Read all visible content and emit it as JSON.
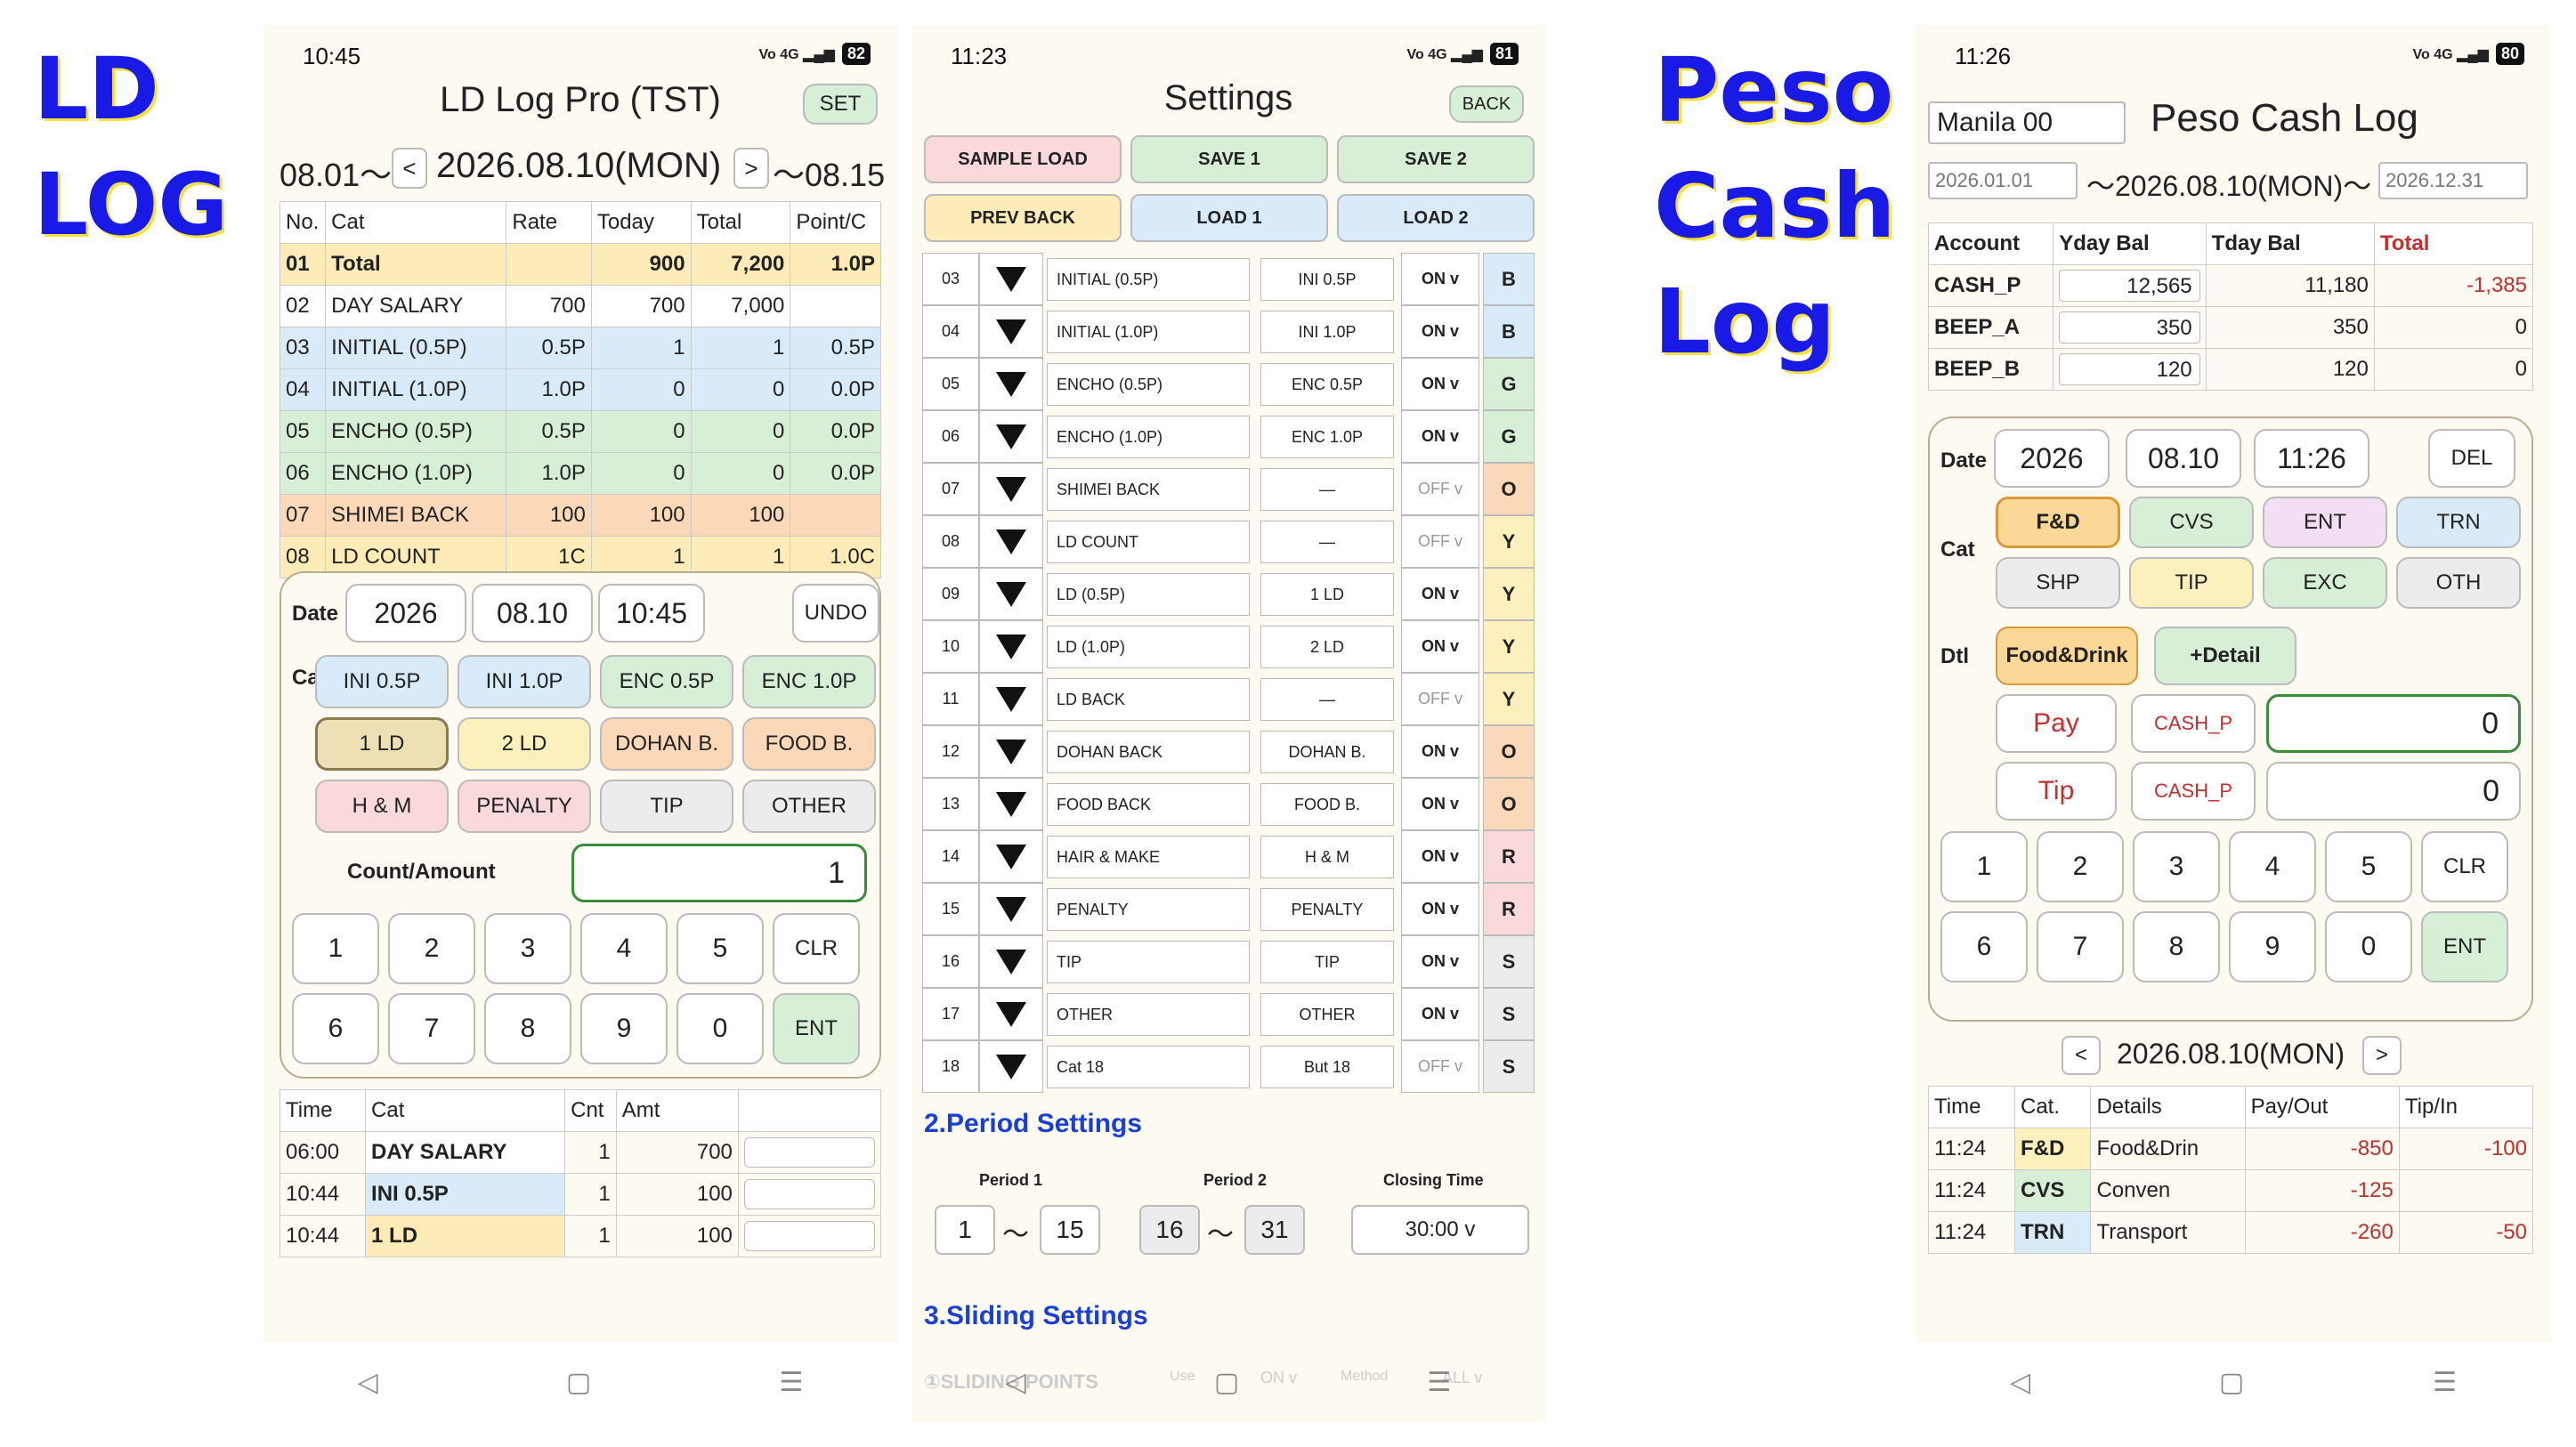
{
  "labels": {
    "ld1": "LD",
    "ld2": "LOG",
    "peso1": "Peso",
    "peso2": "Cash",
    "peso3": "Log"
  },
  "nav": {
    "back": "◁",
    "home": "▢",
    "menu": "☰"
  },
  "p1": {
    "status_time": "10:45",
    "net": "Vo LTE 4G",
    "battery": "82",
    "title": "LD Log Pro (TST)",
    "set": "SET",
    "period_start": "08.01〜",
    "prev": "<",
    "date": "2026.08.10(MON)",
    "next": ">",
    "period_end": "〜08.15",
    "headers": [
      "No.",
      "Cat",
      "Rate",
      "Today",
      "Total",
      "Point/C"
    ],
    "rows": [
      {
        "no": "01",
        "cat": "Total",
        "rate": "",
        "today": "900",
        "total": "7,200",
        "point": "1.0P",
        "color": "#fdebb8"
      },
      {
        "no": "02",
        "cat": "DAY SALARY",
        "rate": "700",
        "today": "700",
        "total": "7,000",
        "point": "",
        "color": "#ffffff"
      },
      {
        "no": "03",
        "cat": "INITIAL (0.5P)",
        "rate": "0.5P",
        "today": "1",
        "total": "1",
        "point": "0.5P",
        "color": "#d9ebf8"
      },
      {
        "no": "04",
        "cat": "INITIAL (1.0P)",
        "rate": "1.0P",
        "today": "0",
        "total": "0",
        "point": "0.0P",
        "color": "#d9ebf8"
      },
      {
        "no": "05",
        "cat": "ENCHO (0.5P)",
        "rate": "0.5P",
        "today": "0",
        "total": "0",
        "point": "0.0P",
        "color": "#d7efd6"
      },
      {
        "no": "06",
        "cat": "ENCHO (1.0P)",
        "rate": "1.0P",
        "today": "0",
        "total": "0",
        "point": "0.0P",
        "color": "#d7efd6"
      },
      {
        "no": "07",
        "cat": "SHIMEI BACK",
        "rate": "100",
        "today": "100",
        "total": "100",
        "point": "",
        "color": "#fbd9b8"
      },
      {
        "no": "08",
        "cat": "LD COUNT",
        "rate": "1C",
        "today": "1",
        "total": "1",
        "point": "1.0C",
        "color": "#fdebb8"
      }
    ],
    "date_label": "Date",
    "year": "2026",
    "md": "08.10",
    "time": "10:45",
    "undo": "UNDO",
    "cat_label": "Cat",
    "cats": [
      {
        "t": "INI 0.5P",
        "c": "#d9ebf8"
      },
      {
        "t": "INI 1.0P",
        "c": "#d9ebf8"
      },
      {
        "t": "ENC 0.5P",
        "c": "#d7efd6"
      },
      {
        "t": "ENC 1.0P",
        "c": "#d7efd6"
      },
      {
        "t": "1 LD",
        "c": "#ece0b4"
      },
      {
        "t": "2 LD",
        "c": "#fcf0bc"
      },
      {
        "t": "DOHAN B.",
        "c": "#fbd9b8"
      },
      {
        "t": "FOOD B.",
        "c": "#fbd9b8"
      },
      {
        "t": "H & M",
        "c": "#f9d9d9"
      },
      {
        "t": "PENALTY",
        "c": "#f9d9d9"
      },
      {
        "t": "TIP",
        "c": "#ececec"
      },
      {
        "t": "OTHER",
        "c": "#ececec"
      }
    ],
    "count_label": "Count/Amount",
    "count_value": "1",
    "keys": [
      "1",
      "2",
      "3",
      "4",
      "5",
      "CLR",
      "6",
      "7",
      "8",
      "9",
      "0",
      "ENT"
    ],
    "log_headers": [
      "Time",
      "Cat",
      "Cnt",
      "Amt",
      ""
    ],
    "logs": [
      {
        "time": "06:00",
        "cat": "DAY SALARY",
        "cnt": "1",
        "amt": "700",
        "color": "#ffffff"
      },
      {
        "time": "10:44",
        "cat": "INI 0.5P",
        "cnt": "1",
        "amt": "100",
        "color": "#d9ebf8"
      },
      {
        "time": "10:44",
        "cat": "1 LD",
        "cnt": "1",
        "amt": "100",
        "color": "#fdebb8"
      }
    ]
  },
  "p2": {
    "status_time": "11:23",
    "battery": "81",
    "title": "Settings",
    "back": "BACK",
    "buttons": [
      {
        "t": "SAMPLE LOAD",
        "c": "#f9d9d9"
      },
      {
        "t": "SAVE 1",
        "c": "#d7efd6"
      },
      {
        "t": "SAVE 2",
        "c": "#d7efd6"
      },
      {
        "t": "PREV BACK",
        "c": "#fdebb8"
      },
      {
        "t": "LOAD 1",
        "c": "#d9ebf8"
      },
      {
        "t": "LOAD 2",
        "c": "#d9ebf8"
      }
    ],
    "rows": [
      {
        "n": "03",
        "name": "INITIAL (0.5P)",
        "btn": "INI 0.5P",
        "on": "ON v",
        "g": "B",
        "c": "#d9ebf8"
      },
      {
        "n": "04",
        "name": "INITIAL (1.0P)",
        "btn": "INI 1.0P",
        "on": "ON v",
        "g": "B",
        "c": "#d9ebf8"
      },
      {
        "n": "05",
        "name": "ENCHO (0.5P)",
        "btn": "ENC 0.5P",
        "on": "ON v",
        "g": "G",
        "c": "#d7efd6"
      },
      {
        "n": "06",
        "name": "ENCHO (1.0P)",
        "btn": "ENC 1.0P",
        "on": "ON v",
        "g": "G",
        "c": "#d7efd6"
      },
      {
        "n": "07",
        "name": "SHIMEI BACK",
        "btn": "—",
        "on": "OFF v",
        "g": "O",
        "c": "#fbd9b8"
      },
      {
        "n": "08",
        "name": "LD COUNT",
        "btn": "—",
        "on": "OFF v",
        "g": "Y",
        "c": "#fcf0bc"
      },
      {
        "n": "09",
        "name": "LD (0.5P)",
        "btn": "1 LD",
        "on": "ON v",
        "g": "Y",
        "c": "#fcf0bc"
      },
      {
        "n": "10",
        "name": "LD (1.0P)",
        "btn": "2 LD",
        "on": "ON v",
        "g": "Y",
        "c": "#fcf0bc"
      },
      {
        "n": "11",
        "name": "LD BACK",
        "btn": "—",
        "on": "OFF v",
        "g": "Y",
        "c": "#fcf0bc"
      },
      {
        "n": "12",
        "name": "DOHAN BACK",
        "btn": "DOHAN B.",
        "on": "ON v",
        "g": "O",
        "c": "#fbd9b8"
      },
      {
        "n": "13",
        "name": "FOOD BACK",
        "btn": "FOOD B.",
        "on": "ON v",
        "g": "O",
        "c": "#fbd9b8"
      },
      {
        "n": "14",
        "name": "HAIR & MAKE",
        "btn": "H & M",
        "on": "ON v",
        "g": "R",
        "c": "#f9d9d9"
      },
      {
        "n": "15",
        "name": "PENALTY",
        "btn": "PENALTY",
        "on": "ON v",
        "g": "R",
        "c": "#f9d9d9"
      },
      {
        "n": "16",
        "name": "TIP",
        "btn": "TIP",
        "on": "ON v",
        "g": "S",
        "c": "#ececec"
      },
      {
        "n": "17",
        "name": "OTHER",
        "btn": "OTHER",
        "on": "ON v",
        "g": "S",
        "c": "#ececec"
      },
      {
        "n": "18",
        "name": "Cat 18",
        "btn": "But 18",
        "on": "OFF v",
        "g": "S",
        "c": "#ececec"
      }
    ],
    "period_head": "2.Period Settings",
    "period1": "Period 1",
    "period2": "Period 2",
    "closing": "Closing Time",
    "p1a": "1",
    "p1b": "15",
    "p2a": "16",
    "p2b": "31",
    "tilde": "〜",
    "close_val": "30:00  v",
    "sliding_head": "3.Sliding Settings",
    "sliding_row": "①SLIDING POINTS",
    "use": "Use",
    "use_val": "ON  v",
    "method": "Method",
    "method_val": "ALL  v"
  },
  "p3": {
    "status_time": "11:26",
    "battery": "80",
    "account_name": "Manila 00",
    "title": "Peso Cash Log",
    "from": "2026.01.01",
    "date": "〜2026.08.10(MON)〜",
    "to": "2026.12.31",
    "acc_headers": [
      "Account",
      "Yday Bal",
      "Tday Bal",
      "Total"
    ],
    "accounts": [
      {
        "name": "CASH_P",
        "yday": "12,565",
        "tday": "11,180",
        "total": "-1,385"
      },
      {
        "name": "BEEP_A",
        "yday": "350",
        "tday": "350",
        "total": "0"
      },
      {
        "name": "BEEP_B",
        "yday": "120",
        "tday": "120",
        "total": "0"
      }
    ],
    "date_label": "Date",
    "year": "2026",
    "md": "08.10",
    "time": "11:26",
    "del": "DEL",
    "cat_label": "Cat",
    "cats": [
      {
        "t": "F&D",
        "c": "#fcd896"
      },
      {
        "t": "CVS",
        "c": "#d7efd6"
      },
      {
        "t": "ENT",
        "c": "#f3dff3"
      },
      {
        "t": "TRN",
        "c": "#d9ebf8"
      },
      {
        "t": "SHP",
        "c": "#ececec"
      },
      {
        "t": "TIP",
        "c": "#fcf0bc"
      },
      {
        "t": "EXC",
        "c": "#d7efd6"
      },
      {
        "t": "OTH",
        "c": "#ececec"
      }
    ],
    "dtl_label": "Dtl",
    "dtl1": "Food&Drink",
    "dtl2": "+Detail",
    "pay": "Pay",
    "pay_acc": "CASH_P",
    "pay_val": "0",
    "tip": "Tip",
    "tip_acc": "CASH_P",
    "tip_val": "0",
    "keys": [
      "1",
      "2",
      "3",
      "4",
      "5",
      "CLR",
      "6",
      "7",
      "8",
      "9",
      "0",
      "ENT"
    ],
    "prev": "<",
    "nav_date": "2026.08.10(MON)",
    "next": ">",
    "log_headers": [
      "Time",
      "Cat.",
      "Details",
      "Pay/Out",
      "Tip/In"
    ],
    "logs": [
      {
        "time": "11:24",
        "cat": "F&D",
        "det": "Food&Drin",
        "pay": "-850",
        "tip": "-100",
        "c": "#fcf0bc"
      },
      {
        "time": "11:24",
        "cat": "CVS",
        "det": "Conven",
        "pay": "-125",
        "tip": "",
        "c": "#d7efd6"
      },
      {
        "time": "11:24",
        "cat": "TRN",
        "det": "Transport",
        "pay": "-260",
        "tip": "-50",
        "c": "#d9ebf8"
      }
    ]
  }
}
